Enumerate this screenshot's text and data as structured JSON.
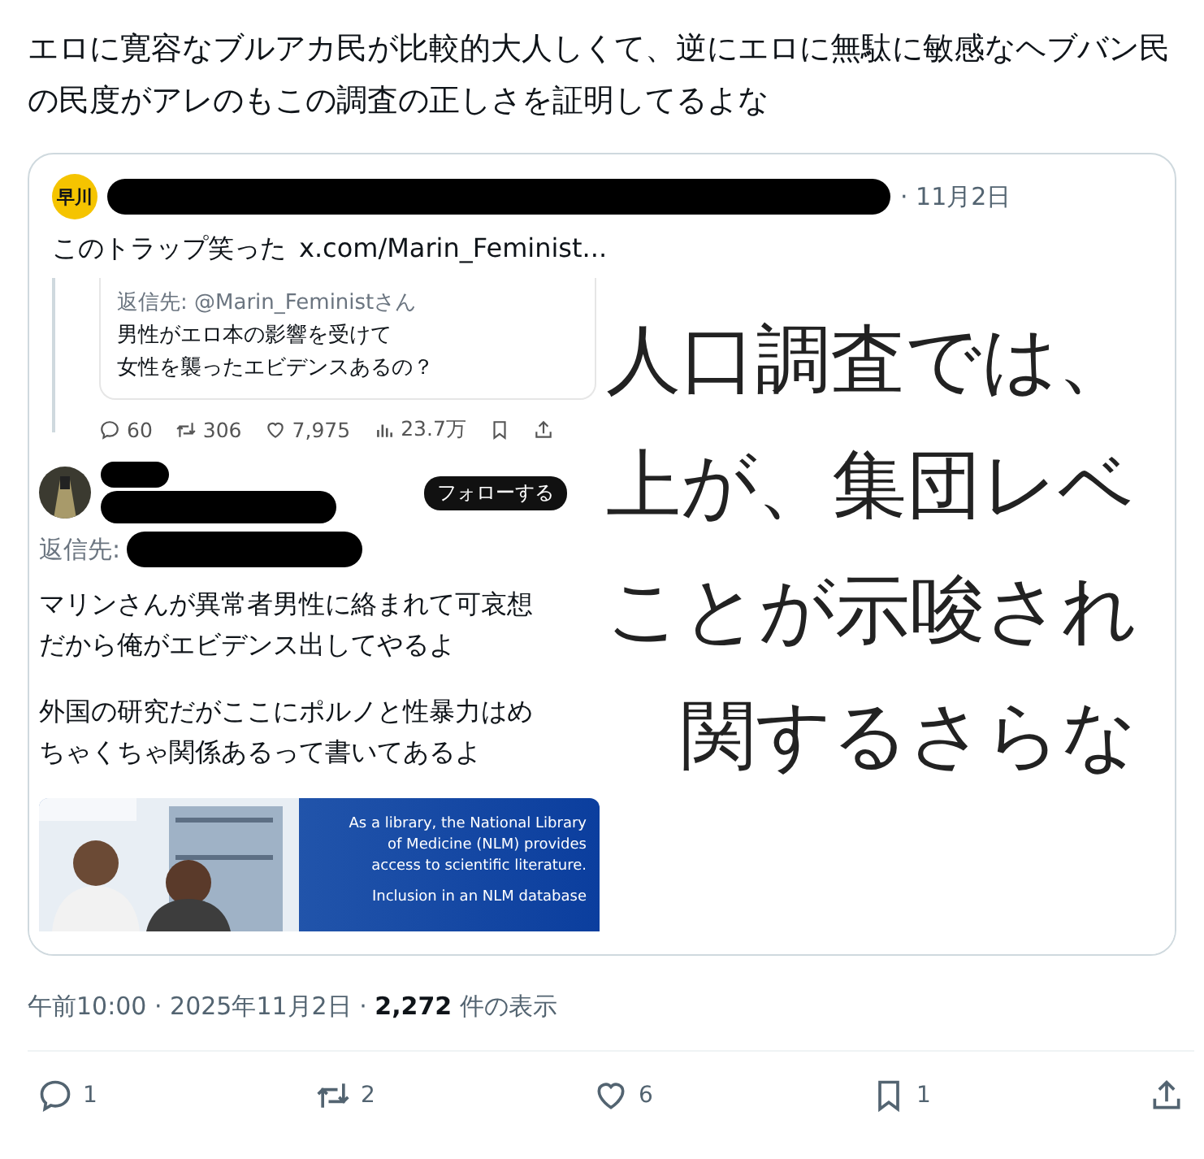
{
  "tweet": {
    "text": "エロに寛容なブルアカ民が比較的大人しくて、逆にエロに無駄に敏感なヘブバン民の民度がアレのもこの調査の正しさを証明してるよな"
  },
  "quote": {
    "avatar_text": "早川",
    "date": "· 11月2日",
    "text": "このトラップ笑った",
    "link": "x.com/Marin_Feminist...",
    "screenshot": {
      "inner_reply_to": "返信先: @Marin_Feministさん",
      "inner_lines": [
        "男性がエロ本の影響を受けて",
        "女性を襲ったエビデンスあるの？"
      ],
      "stats": [
        {
          "kind": "reply",
          "count": "60"
        },
        {
          "kind": "retweet",
          "count": "306"
        },
        {
          "kind": "like",
          "count": "7,975"
        },
        {
          "kind": "views",
          "count": "23.7万"
        },
        {
          "kind": "bookmark"
        },
        {
          "kind": "share"
        }
      ],
      "follow": "フォローする",
      "reply_to": "返信先:",
      "paragraphs": [
        [
          "マリンさんが異常者男性に絡まれて可哀想",
          "だから俺がエビデンス出してやるよ"
        ],
        [
          "外国の研究だがここにポルノと性暴力はめ",
          "ちゃくちゃ関係あるって書いてあるよ"
        ]
      ],
      "banner_lines": [
        "As a library, the National Library",
        "of Medicine (NLM) provides",
        "access to scientific literature.",
        "Inclusion in an NLM database"
      ]
    },
    "zoomed_lines": [
      "人口調査では、",
      "上が、集団レベ",
      "ことが示唆され",
      "関するさらな"
    ]
  },
  "meta": {
    "text": "午前10:00 · 2025年11月2日 · **2,272** 件の表示"
  },
  "actions": [
    {
      "kind": "reply",
      "count": "1"
    },
    {
      "kind": "retweet",
      "count": "2"
    },
    {
      "kind": "like",
      "count": "6"
    },
    {
      "kind": "bookmark",
      "count": "1"
    },
    {
      "kind": "share"
    }
  ]
}
